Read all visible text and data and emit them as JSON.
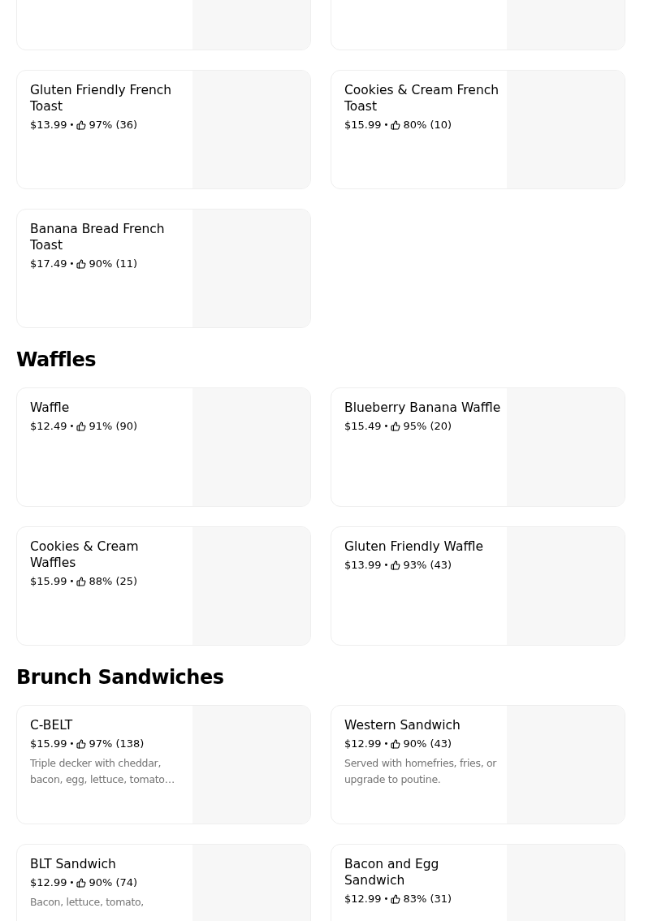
{
  "sections": [
    {
      "items": [
        {
          "kind": "cut"
        },
        {
          "kind": "cut"
        },
        {
          "kind": "item",
          "name": "Gluten Friendly French Toast",
          "price": "$13.99",
          "separator": "•",
          "rating": "97% (36)"
        },
        {
          "kind": "item",
          "name": "Cookies & Cream French Toast",
          "price": "$15.99",
          "separator": "•",
          "rating": "80% (10)"
        },
        {
          "kind": "item",
          "name": "Banana Bread French Toast",
          "price": "$17.49",
          "separator": "•",
          "rating": "90% (11)"
        }
      ]
    },
    {
      "title": "Waffles",
      "items": [
        {
          "kind": "item",
          "name": "Waffle",
          "price": "$12.49",
          "separator": "•",
          "rating": "91% (90)"
        },
        {
          "kind": "item",
          "name": "Blueberry Banana Waffle",
          "price": "$15.49",
          "separator": "•",
          "rating": "95% (20)"
        },
        {
          "kind": "item",
          "name": "Cookies & Cream Waffles",
          "price": "$15.99",
          "separator": "•",
          "rating": "88% (25)"
        },
        {
          "kind": "item",
          "name": "Gluten Friendly Waffle",
          "price": "$13.99",
          "separator": "•",
          "rating": "93% (43)"
        }
      ]
    },
    {
      "title": "Brunch Sandwiches",
      "items": [
        {
          "kind": "item",
          "name": "C-BELT",
          "price": "$15.99",
          "separator": "•",
          "rating": "97% (138)",
          "description": "Triple decker with cheddar, bacon, egg, lettuce, tomato…"
        },
        {
          "kind": "item",
          "name": "Western Sandwich",
          "price": "$12.99",
          "separator": "•",
          "rating": "90% (43)",
          "description": "Served with homefries, fries, or upgrade to poutine."
        },
        {
          "kind": "item",
          "name": "BLT Sandwich",
          "price": "$12.99",
          "separator": "•",
          "rating": "90% (74)",
          "description": "Bacon, lettuce, tomato,"
        },
        {
          "kind": "item",
          "name": "Bacon and Egg Sandwich",
          "price": "$12.99",
          "separator": "•",
          "rating": "83% (31)"
        }
      ]
    }
  ]
}
